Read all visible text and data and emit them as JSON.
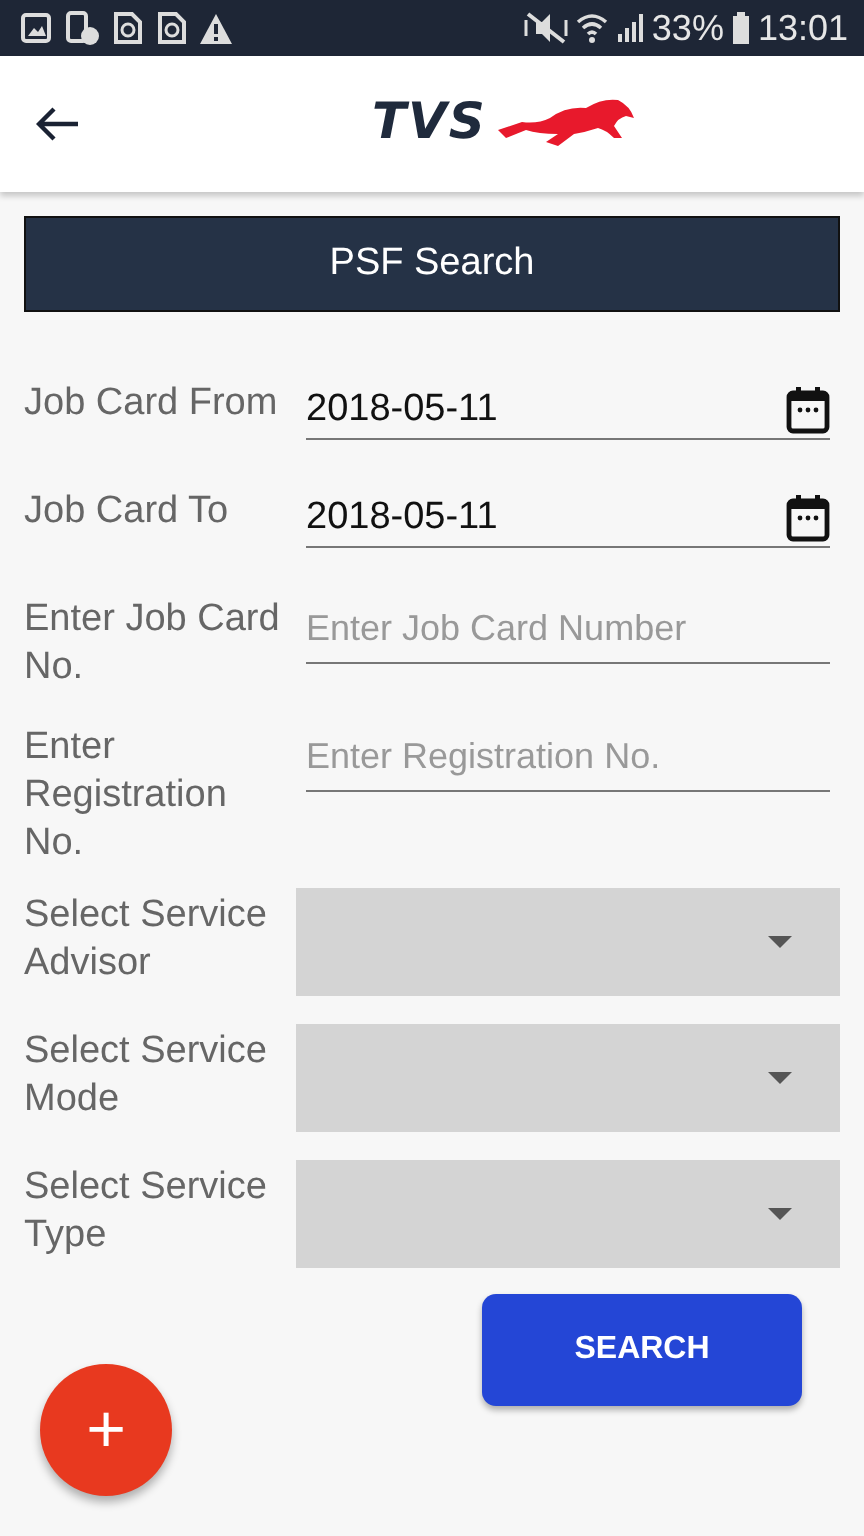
{
  "status_bar": {
    "battery": "33%",
    "time": "13:01"
  },
  "header": {
    "logo_text": "TVS"
  },
  "title": "PSF Search",
  "fields": [
    {
      "kind": "date",
      "label": "Job Card From",
      "value": "2018-05-11"
    },
    {
      "kind": "date",
      "label": "Job Card To",
      "value": "2018-05-11"
    },
    {
      "kind": "text",
      "label": "Enter Job Card No.",
      "placeholder": "Enter Job Card Number"
    },
    {
      "kind": "text",
      "label": "Enter Registration No.",
      "placeholder": "Enter Registration No."
    },
    {
      "kind": "select",
      "label": "Select Service Advisor"
    },
    {
      "kind": "select",
      "label": "Select Service Mode"
    },
    {
      "kind": "select",
      "label": "Select Service Type"
    }
  ],
  "search_button": "SEARCH",
  "fab": "+"
}
